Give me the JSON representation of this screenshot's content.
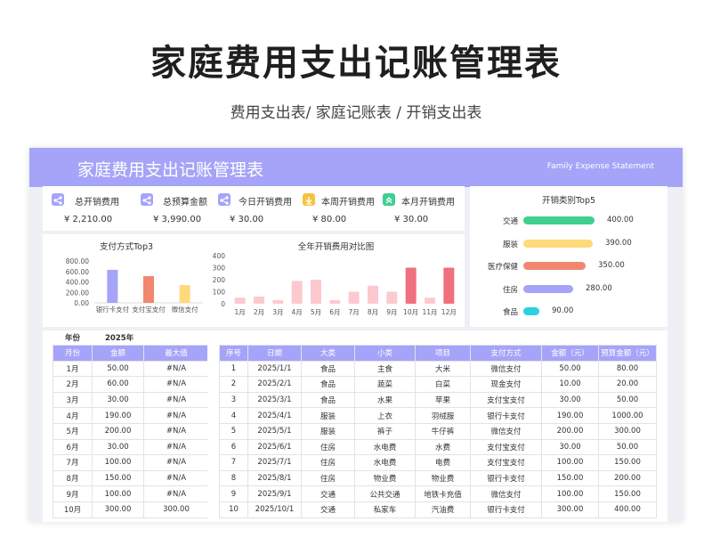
{
  "header": {
    "title": "家庭费用支出记账管理表",
    "subtitle": "费用支出表/ 家庭记账表 / 开销支出表"
  },
  "banner": {
    "title": "家庭费用支出记账管理表",
    "en": "Family Expense Statement"
  },
  "kpi": {
    "total_label": "总开销费用",
    "total_value": "¥ 2,210.00",
    "budget_label": "总预算金额",
    "budget_value": "¥ 3,990.00",
    "today_label": "今日开销费用",
    "today_value": "¥ 30.00",
    "week_label": "本周开销费用",
    "week_value": "¥ 80.00",
    "month_label": "本月开销费用",
    "month_value": "¥ 30.00"
  },
  "colors": {
    "accent": "#a5a4f8",
    "green": "#3fcf8e",
    "yellow": "#ffd97a",
    "salmon": "#f2876f",
    "purple": "#a5a4f8",
    "cyan": "#2ad1e0",
    "pink_light": "#fcc9cf",
    "pink_dark": "#f0707f"
  },
  "top5": {
    "title": "开销类别Top5",
    "items": [
      {
        "label": "交通",
        "value": "400.00",
        "amount": 400,
        "color": "#3fcf8e"
      },
      {
        "label": "服装",
        "value": "390.00",
        "amount": 390,
        "color": "#ffd97a"
      },
      {
        "label": "医疗保健",
        "value": "350.00",
        "amount": 350,
        "color": "#f2876f"
      },
      {
        "label": "住房",
        "value": "280.00",
        "amount": 280,
        "color": "#a5a4f8"
      },
      {
        "label": "食品",
        "value": "90.00",
        "amount": 90,
        "color": "#2ad1e0"
      }
    ]
  },
  "chart_data": [
    {
      "type": "bar",
      "title": "支付方式Top3",
      "categories": [
        "银行卡支付",
        "支付宝支付",
        "微信支付"
      ],
      "values": [
        630,
        510,
        340
      ],
      "colors": [
        "#a5a4f8",
        "#f2876f",
        "#ffd97a"
      ],
      "ylim": [
        0,
        800
      ],
      "yticks": [
        "0.00",
        "200.00",
        "400.00",
        "600.00",
        "800.00"
      ]
    },
    {
      "type": "bar",
      "title": "全年开销费用对比图",
      "categories": [
        "1月",
        "2月",
        "3月",
        "4月",
        "5月",
        "6月",
        "7月",
        "8月",
        "9月",
        "10月",
        "11月",
        "12月"
      ],
      "values": [
        50,
        60,
        30,
        190,
        200,
        30,
        100,
        150,
        100,
        300,
        50,
        300
      ],
      "highlight": [
        false,
        false,
        false,
        false,
        false,
        false,
        false,
        false,
        false,
        true,
        false,
        true
      ],
      "ylim": [
        0,
        400
      ],
      "yticks": [
        "0",
        "100",
        "200",
        "300",
        "400"
      ]
    }
  ],
  "month_table": {
    "year_label": "年份",
    "year_value": "2025年",
    "headers": [
      "月份",
      "金额",
      "最大值"
    ],
    "rows": [
      [
        "1月",
        "50.00",
        "#N/A"
      ],
      [
        "2月",
        "60.00",
        "#N/A"
      ],
      [
        "3月",
        "30.00",
        "#N/A"
      ],
      [
        "4月",
        "190.00",
        "#N/A"
      ],
      [
        "5月",
        "200.00",
        "#N/A"
      ],
      [
        "6月",
        "30.00",
        "#N/A"
      ],
      [
        "7月",
        "100.00",
        "#N/A"
      ],
      [
        "8月",
        "150.00",
        "#N/A"
      ],
      [
        "9月",
        "100.00",
        "#N/A"
      ],
      [
        "10月",
        "300.00",
        "300.00"
      ]
    ]
  },
  "detail_table": {
    "headers": [
      "序号",
      "日期",
      "大类",
      "小类",
      "项目",
      "支付方式",
      "金额（元）",
      "预算金额（元）"
    ],
    "rows": [
      [
        "1",
        "2025/1/1",
        "食品",
        "主食",
        "大米",
        "微信支付",
        "50.00",
        "80.00"
      ],
      [
        "2",
        "2025/2/1",
        "食品",
        "蔬菜",
        "白菜",
        "现金支付",
        "10.00",
        "20.00"
      ],
      [
        "3",
        "2025/3/1",
        "食品",
        "水果",
        "苹果",
        "支付宝支付",
        "30.00",
        "50.00"
      ],
      [
        "4",
        "2025/4/1",
        "服装",
        "上衣",
        "羽绒服",
        "银行卡支付",
        "190.00",
        "1000.00"
      ],
      [
        "5",
        "2025/5/1",
        "服装",
        "裤子",
        "牛仔裤",
        "微信支付",
        "200.00",
        "300.00"
      ],
      [
        "6",
        "2025/6/1",
        "住房",
        "水电费",
        "水费",
        "支付宝支付",
        "30.00",
        "50.00"
      ],
      [
        "7",
        "2025/7/1",
        "住房",
        "水电费",
        "电费",
        "支付宝支付",
        "100.00",
        "150.00"
      ],
      [
        "8",
        "2025/8/1",
        "住房",
        "物业费",
        "物业费",
        "银行卡支付",
        "150.00",
        "200.00"
      ],
      [
        "9",
        "2025/9/1",
        "交通",
        "公共交通",
        "地铁卡充值",
        "微信支付",
        "100.00",
        "150.00"
      ],
      [
        "10",
        "2025/10/1",
        "交通",
        "私家车",
        "汽油费",
        "银行卡支付",
        "300.00",
        "400.00"
      ]
    ]
  }
}
